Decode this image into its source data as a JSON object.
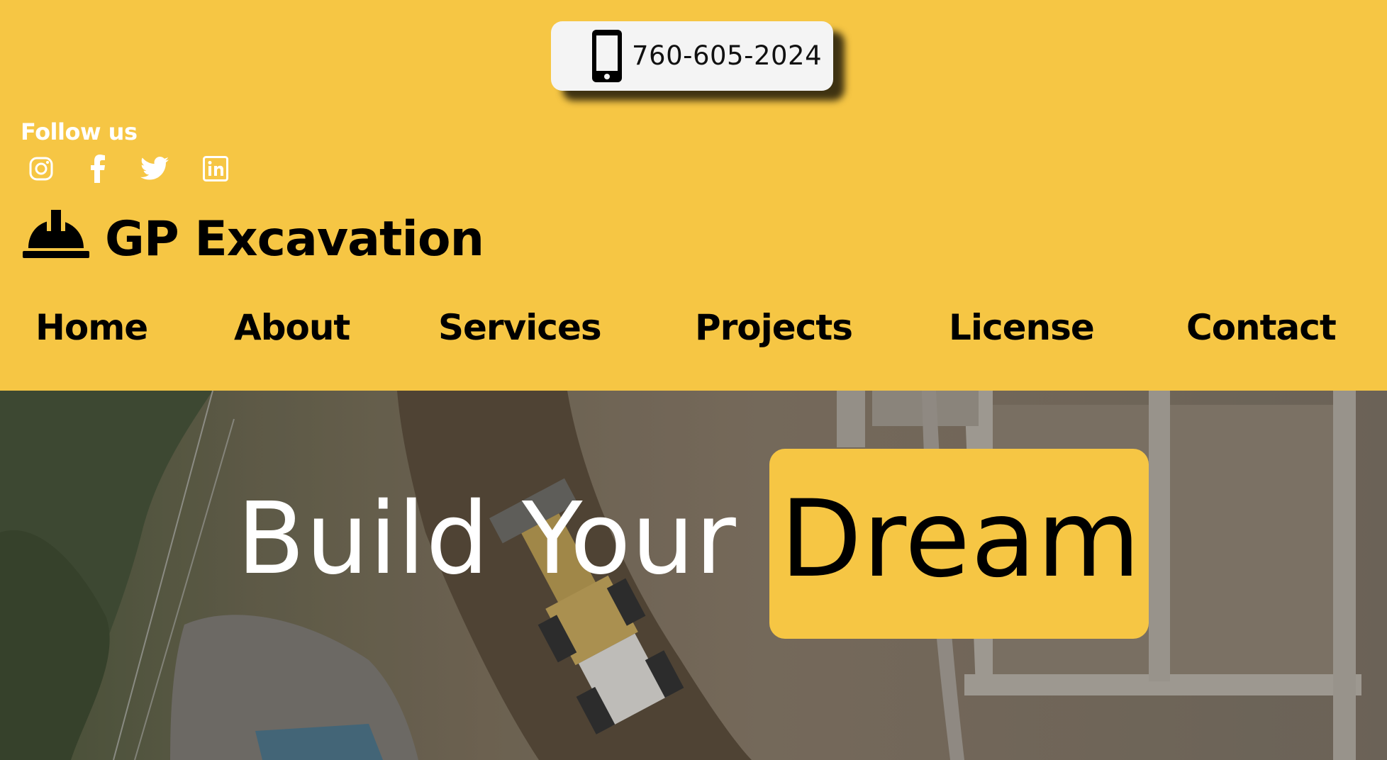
{
  "header": {
    "phone": "760-605-2024",
    "follow_label": "Follow us",
    "social_icons": [
      "instagram-icon",
      "facebook-icon",
      "twitter-icon",
      "linkedin-icon"
    ],
    "brand_name": "GP Excavation",
    "logo_icon": "hard-hat-icon",
    "colors": {
      "background": "#f6c644",
      "text": "#000000",
      "follow_text": "#ffffff"
    }
  },
  "nav": {
    "items": [
      "Home",
      "About",
      "Services",
      "Projects",
      "License",
      "Contact"
    ]
  },
  "hero": {
    "headline": "Build Your",
    "highlight": "Dream",
    "highlight_color": "#f6c644"
  }
}
